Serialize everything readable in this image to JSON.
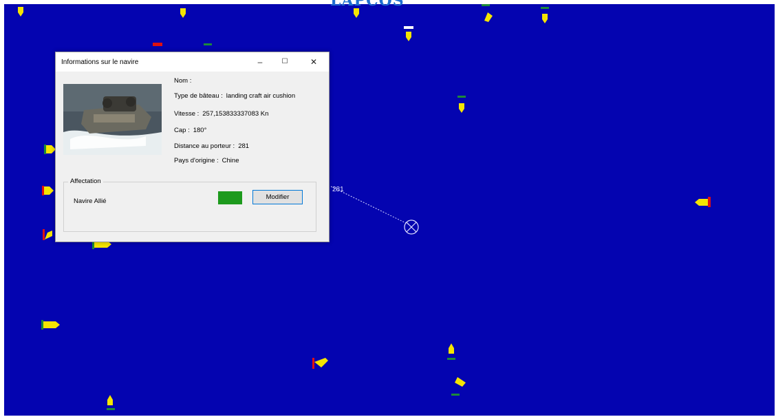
{
  "app": {
    "title": "LAPCOS"
  },
  "map": {
    "sea_color": "#0404b0",
    "ship_color": "#f5e400",
    "allied_color": "#1d8a3a",
    "enemy_color": "#e01010",
    "neutral_color": "#ffffff",
    "distance_label": "281"
  },
  "dialog": {
    "title": "Informations sur le navire",
    "minimize": "–",
    "maximize": "☐",
    "close": "✕",
    "fields": {
      "name_label": "Nom :",
      "name_value": "",
      "type_label": "Type de bâteau :",
      "type_value": "landing craft air cushion",
      "speed_label": "Vitesse :",
      "speed_value": "257,153833337083 Kn",
      "heading_label": "Cap :",
      "heading_value": "180°",
      "distance_label": "Distance au porteur :",
      "distance_value": "281",
      "country_label": "Pays d'origine :",
      "country_value": "Chine"
    },
    "assignment": {
      "legend": "Affectation",
      "status": "Navire Allié",
      "color": "#1d9a1d",
      "button": "Modifier"
    }
  }
}
